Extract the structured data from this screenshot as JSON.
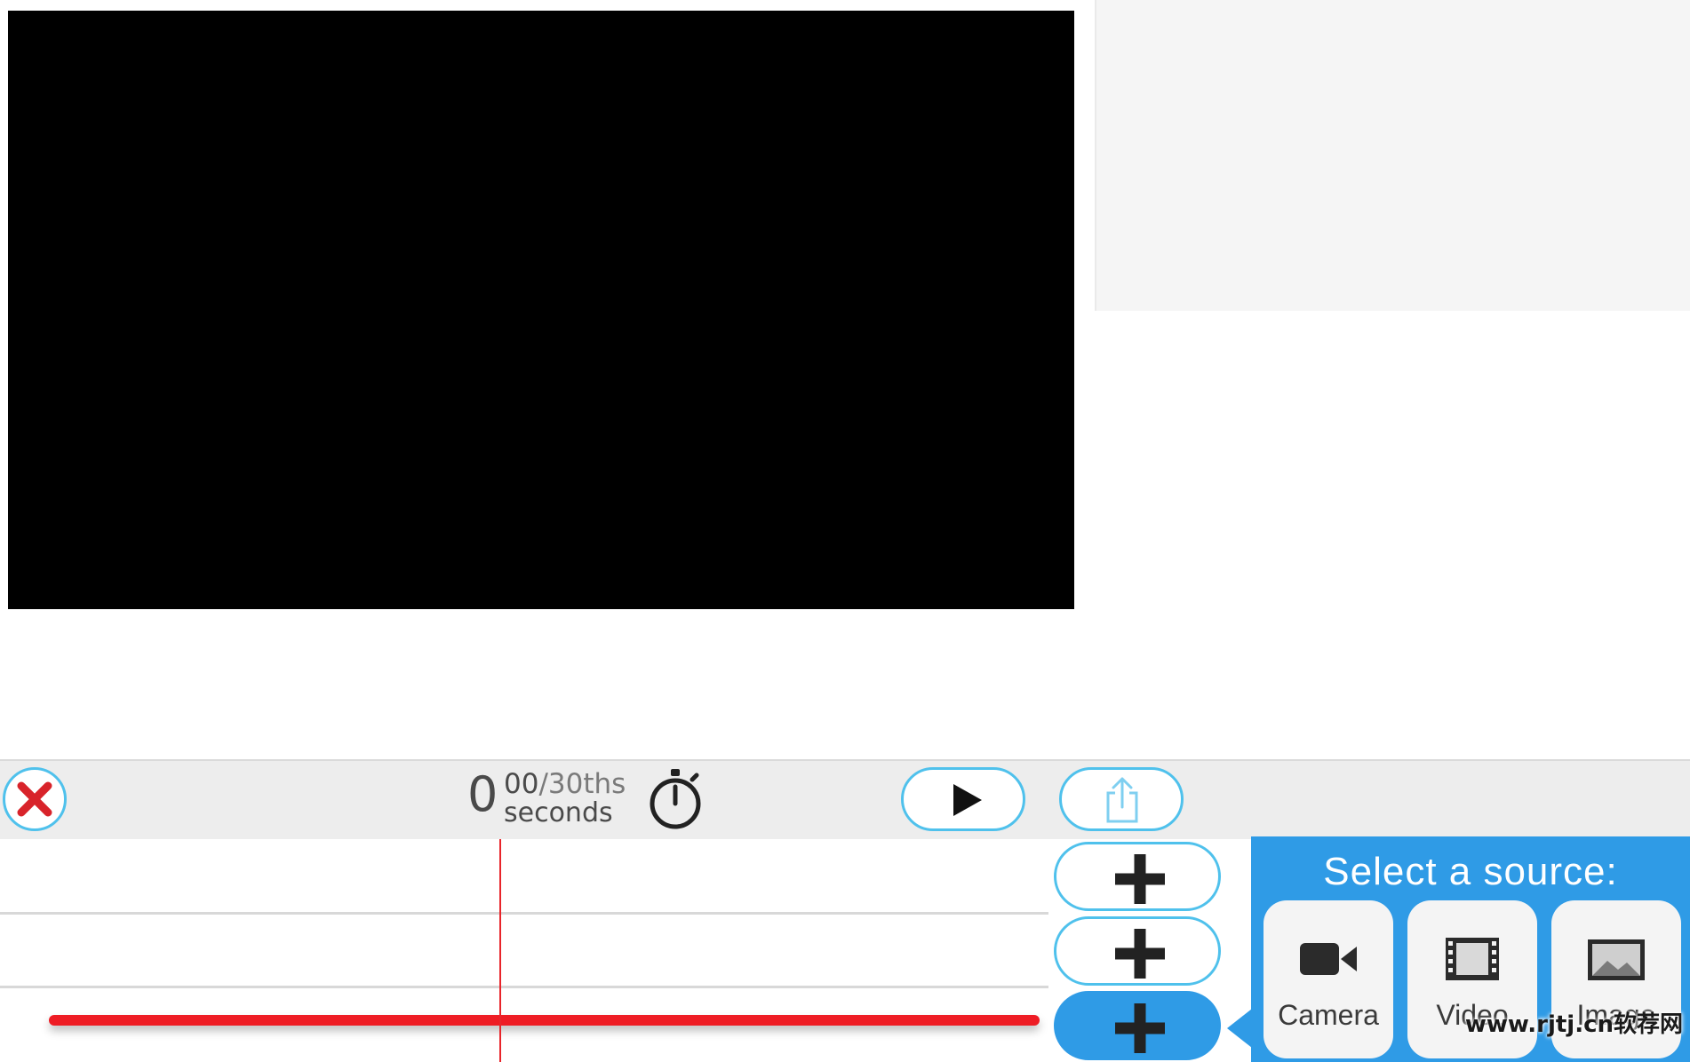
{
  "timer": {
    "seconds": "0",
    "fraction": "00",
    "fraction_unit": "/30ths",
    "unit": "seconds"
  },
  "icons": {
    "close": "close-icon",
    "stopwatch": "stopwatch-icon",
    "play": "play-icon",
    "share": "share-icon",
    "add": "plus-icon",
    "camera": "video-camera-icon",
    "video": "film-strip-icon",
    "image": "image-icon"
  },
  "source_picker": {
    "title": "Select a source:",
    "options": [
      {
        "label": "Camera",
        "icon": "video-camera-icon"
      },
      {
        "label": "Video",
        "icon": "film-strip-icon"
      },
      {
        "label": "Image",
        "icon": "image-icon"
      }
    ]
  },
  "watermark": "www.rjtj.cn软荐网",
  "colors": {
    "accent": "#2f9be6",
    "outline": "#4fc1ec",
    "playhead": "#e8242a",
    "track": "#ee1c24",
    "close": "#d8232a"
  }
}
